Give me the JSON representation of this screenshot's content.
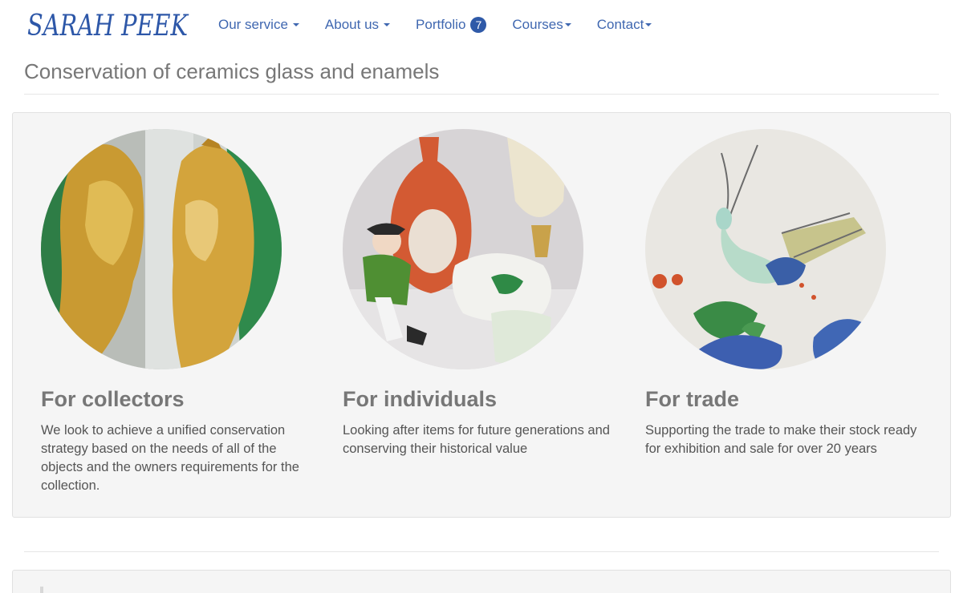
{
  "brand": {
    "logo_text": "SARAH PEEK",
    "color": "#2d57a8"
  },
  "nav": {
    "items": [
      {
        "label": "Our service",
        "has_caret": true
      },
      {
        "label": "About us",
        "has_caret": true
      },
      {
        "label": "Portfolio",
        "badge": "7"
      },
      {
        "label": "Courses",
        "has_caret": true
      },
      {
        "label": "Contact",
        "has_caret": true
      }
    ],
    "link_color": "#3f67b0"
  },
  "page": {
    "title": "Conservation of ceramics glass and enamels"
  },
  "features": [
    {
      "heading": "For collectors",
      "text": "We look to achieve a unified conservation strategy based on the needs of all of the objects and the owners requirements for the collection.",
      "image": "gilt-helmet-busts-photo"
    },
    {
      "heading": "For individuals",
      "text": "Looking after items for future generations and conserving their historical value",
      "image": "porcelain-vase-and-teapot-photo"
    },
    {
      "heading": "For trade",
      "text": "Supporting the trade to make their stock ready for exhibition and sale for over 20 years",
      "image": "painted-porcelain-insect-photo"
    }
  ]
}
